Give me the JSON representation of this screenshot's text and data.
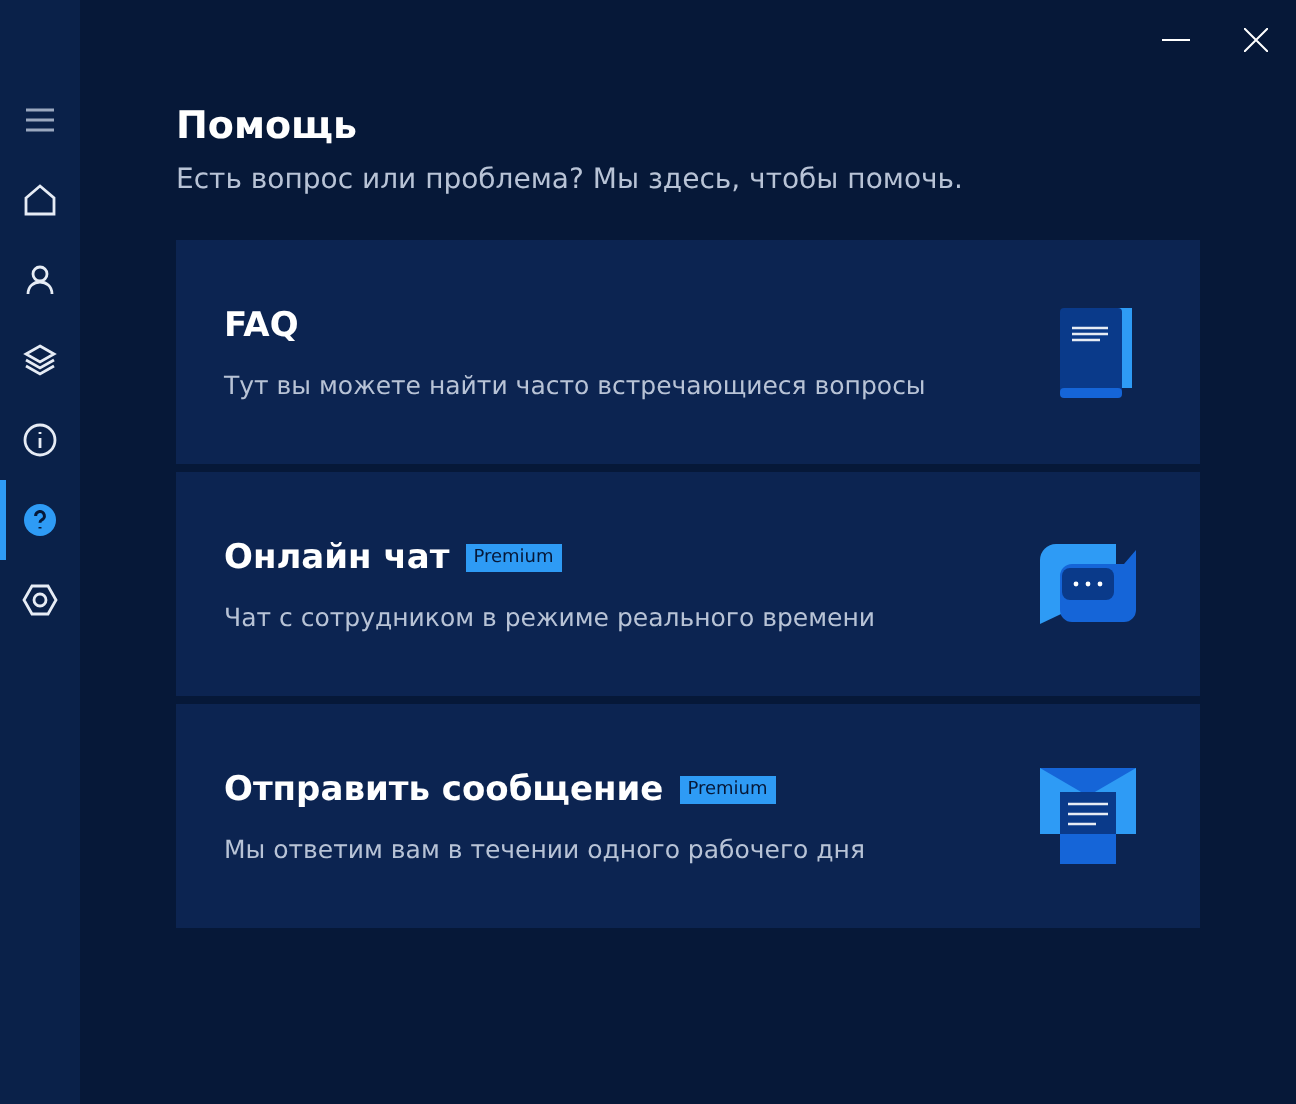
{
  "sidebar": {
    "items": [
      {
        "kind": "menu",
        "selected": false
      },
      {
        "kind": "home",
        "selected": false
      },
      {
        "kind": "user",
        "selected": false
      },
      {
        "kind": "layers",
        "selected": false
      },
      {
        "kind": "info",
        "selected": false
      },
      {
        "kind": "help",
        "selected": true
      },
      {
        "kind": "settings",
        "selected": false
      }
    ]
  },
  "header": {
    "title": "Помощь",
    "subtitle": "Есть вопрос или проблема? Мы здесь, чтобы помочь."
  },
  "cards": [
    {
      "kind": "book",
      "title": "FAQ",
      "description": "Тут вы можете найти часто встречающиеся вопросы"
    },
    {
      "kind": "chat",
      "title": "Онлайн чат",
      "badge": "Premium",
      "description": "Чат с сотрудником в режиме реального времени"
    },
    {
      "kind": "mail",
      "title": "Отправить сообщение",
      "badge": "Premium",
      "description": "Мы ответим вам в течении одного рабочего дня"
    }
  ]
}
